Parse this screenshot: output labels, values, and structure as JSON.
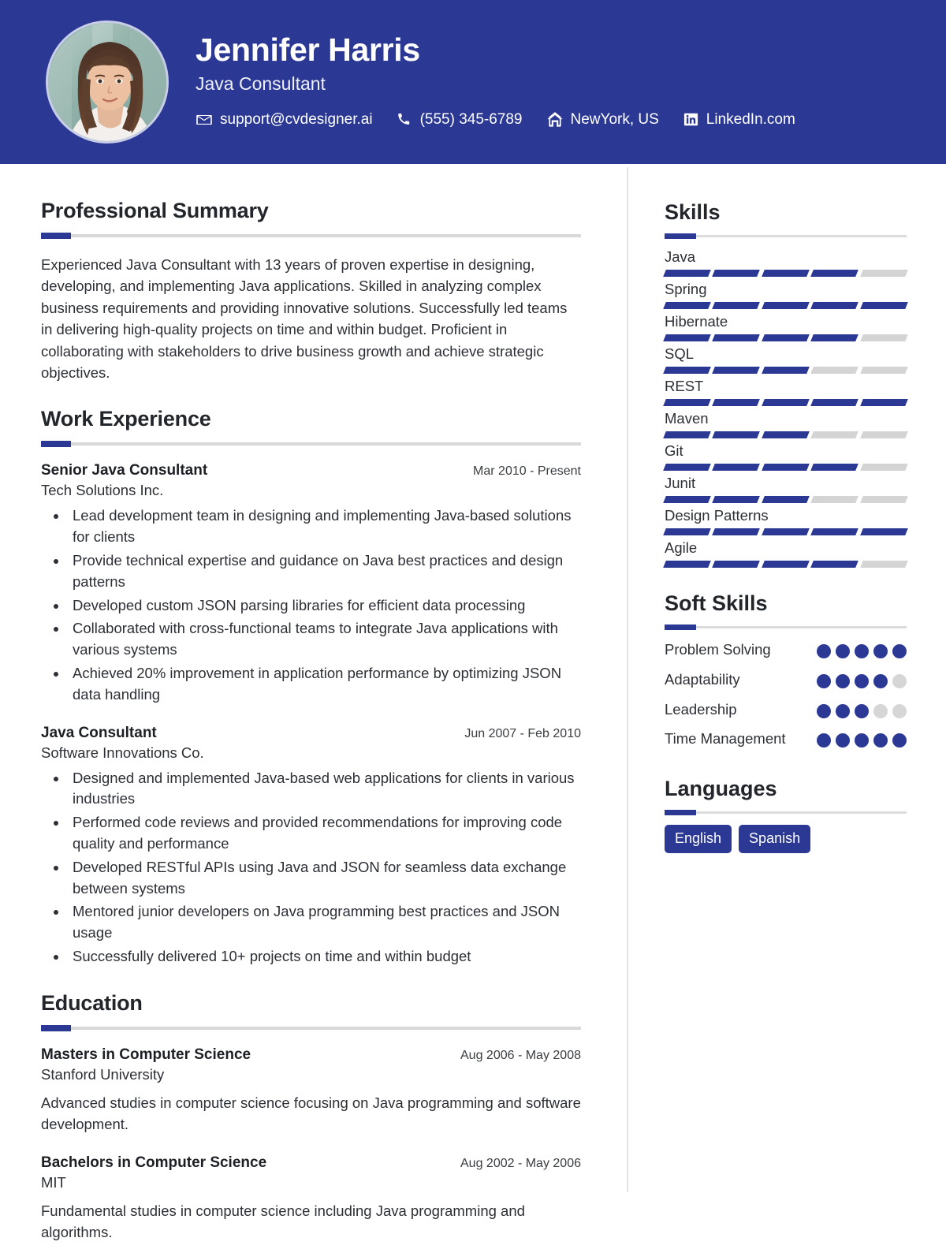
{
  "theme": {
    "primary": "#2b3894",
    "track": "#d4d4d4",
    "rule": "#d8d8d8",
    "text": "#2c2f35"
  },
  "header": {
    "name": "Jennifer Harris",
    "role": "Java Consultant",
    "avatar_alt": "profile-photo",
    "contacts": [
      {
        "icon": "envelope-icon",
        "label": "support@cvdesigner.ai"
      },
      {
        "icon": "phone-icon",
        "label": "(555) 345-6789"
      },
      {
        "icon": "home-icon",
        "label": "NewYork, US"
      },
      {
        "icon": "linkedin-icon",
        "label": "LinkedIn.com"
      }
    ]
  },
  "summary": {
    "title": "Professional Summary",
    "text": "Experienced Java Consultant with 13 years of proven expertise in designing, developing, and implementing Java applications. Skilled in analyzing complex business requirements and providing innovative solutions. Successfully led teams in delivering high-quality projects on time and within budget. Proficient in collaborating with stakeholders to drive business growth and achieve strategic objectives."
  },
  "experience": {
    "title": "Work Experience",
    "entries": [
      {
        "title": "Senior Java Consultant",
        "date": "Mar 2010 - Present",
        "org": "Tech Solutions Inc.",
        "bullets": [
          "Lead development team in designing and implementing Java-based solutions for clients",
          "Provide technical expertise and guidance on Java best practices and design patterns",
          "Developed custom JSON parsing libraries for efficient data processing",
          "Collaborated with cross-functional teams to integrate Java applications with various systems",
          "Achieved 20% improvement in application performance by optimizing JSON data handling"
        ]
      },
      {
        "title": "Java Consultant",
        "date": "Jun 2007 - Feb 2010",
        "org": "Software Innovations Co.",
        "bullets": [
          "Designed and implemented Java-based web applications for clients in various industries",
          "Performed code reviews and provided recommendations for improving code quality and performance",
          "Developed RESTful APIs using Java and JSON for seamless data exchange between systems",
          "Mentored junior developers on Java programming best practices and JSON usage",
          "Successfully delivered 10+ projects on time and within budget"
        ]
      }
    ]
  },
  "education": {
    "title": "Education",
    "entries": [
      {
        "title": "Masters in Computer Science",
        "date": "Aug 2006 - May 2008",
        "org": "Stanford University",
        "desc": "Advanced studies in computer science focusing on Java programming and software development."
      },
      {
        "title": "Bachelors in Computer Science",
        "date": "Aug 2002 - May 2006",
        "org": "MIT",
        "desc": "Fundamental studies in computer science including Java programming and algorithms."
      }
    ]
  },
  "skills": {
    "title": "Skills",
    "max": 5,
    "items": [
      {
        "name": "Java",
        "level": 4
      },
      {
        "name": "Spring",
        "level": 5
      },
      {
        "name": "Hibernate",
        "level": 4
      },
      {
        "name": "SQL",
        "level": 3
      },
      {
        "name": "REST",
        "level": 5
      },
      {
        "name": "Maven",
        "level": 3
      },
      {
        "name": "Git",
        "level": 4
      },
      {
        "name": "Junit",
        "level": 3
      },
      {
        "name": "Design Patterns",
        "level": 5
      },
      {
        "name": "Agile",
        "level": 4
      }
    ]
  },
  "soft_skills": {
    "title": "Soft Skills",
    "max": 5,
    "items": [
      {
        "name": "Problem Solving",
        "level": 5
      },
      {
        "name": "Adaptability",
        "level": 4
      },
      {
        "name": "Leadership",
        "level": 3
      },
      {
        "name": "Time Management",
        "level": 5
      }
    ]
  },
  "languages": {
    "title": "Languages",
    "items": [
      "English",
      "Spanish"
    ]
  }
}
